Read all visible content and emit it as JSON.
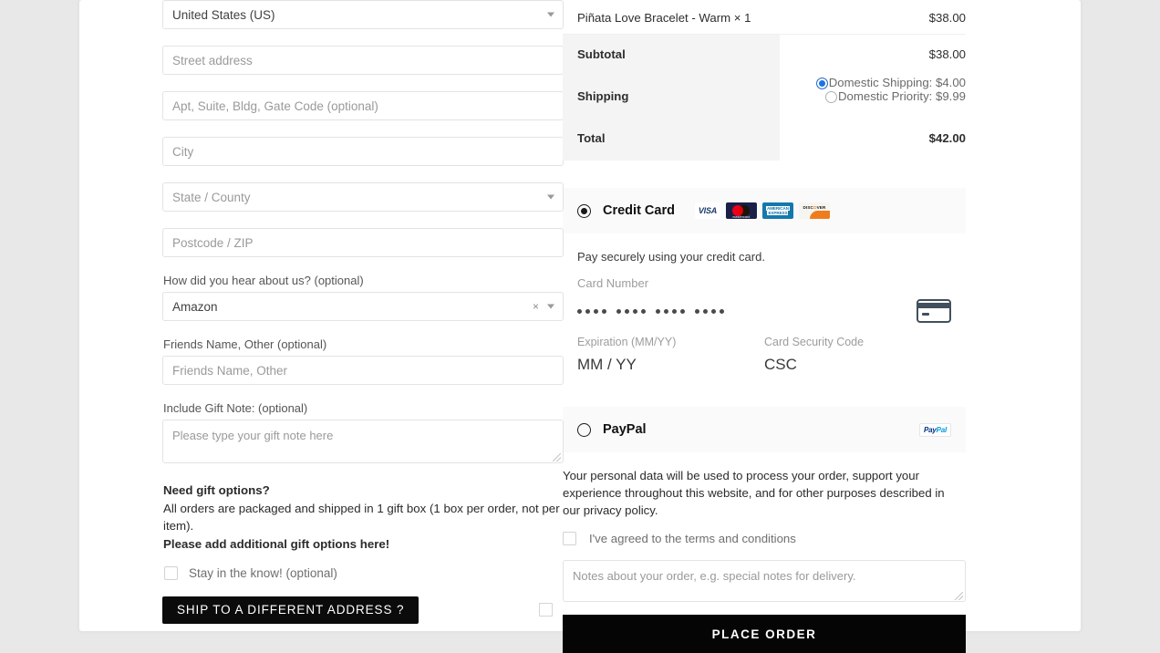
{
  "billing": {
    "country": {
      "value": "United States (US)",
      "icon": "chevron-down-icon"
    },
    "street": {
      "placeholder": "Street address"
    },
    "apt": {
      "placeholder": "Apt, Suite, Bldg, Gate Code (optional)"
    },
    "city": {
      "placeholder": "City"
    },
    "state": {
      "placeholder": "State / County"
    },
    "postcode": {
      "placeholder": "Postcode / ZIP"
    },
    "hear_about": {
      "label": "How did you hear about us? (optional)",
      "value": "Amazon",
      "clear_icon": "×"
    },
    "friends_name": {
      "label": "Friends Name, Other (optional)",
      "placeholder": "Friends Name, Other"
    },
    "gift_note": {
      "label": "Include Gift Note: (optional)",
      "placeholder": "Please type your gift note here"
    },
    "gift_options": {
      "heading": "Need gift options?",
      "line2": "All orders are packaged and shipped in 1 gift box (1 box per order, not per item).",
      "line3": "Please add additional gift options here!"
    },
    "newsletter": {
      "label": "Stay in the know! (optional)",
      "checked": false
    },
    "ship_different": {
      "label": "SHIP TO A DIFFERENT ADDRESS ?",
      "checked": false
    }
  },
  "order": {
    "line_item": {
      "name": "Piñata Love Bracelet - Warm  × 1",
      "amount": "$38.00"
    },
    "subtotal": {
      "label": "Subtotal",
      "amount": "$38.00"
    },
    "shipping": {
      "label": "Shipping",
      "options": [
        {
          "label": "Domestic Shipping: $4.00",
          "selected": true
        },
        {
          "label": "Domestic Priority: $9.99",
          "selected": false
        }
      ]
    },
    "total": {
      "label": "Total",
      "amount": "$42.00"
    }
  },
  "payment": {
    "credit_card": {
      "label": "Credit Card",
      "selected": true,
      "accepted_cards": [
        "VISA",
        "mastercard",
        "AMERICAN EXPRESS",
        "DISCOVER"
      ],
      "description": "Pay securely using your credit card.",
      "card_number_label": "Card Number",
      "card_number_masked": "•••• •••• •••• ••••",
      "card_icon": "credit-card-icon",
      "expiration_label": "Expiration (MM/YY)",
      "expiration_placeholder": "MM / YY",
      "csc_label": "Card Security Code",
      "csc_placeholder": "CSC"
    },
    "paypal": {
      "label": "PayPal",
      "selected": false,
      "logo_text_a": "Pay",
      "logo_text_b": "Pal"
    }
  },
  "footer": {
    "privacy_text": "Your personal data will be used to process your order, support your experience throughout this website, and for other purposes described in our privacy policy.",
    "terms": {
      "label": "I've agreed to the terms and conditions",
      "checked": false
    },
    "notes_placeholder": "Notes about your order, e.g. special notes for delivery.",
    "place_order": "PLACE ORDER"
  },
  "colors": {
    "accent_dark": "#050505",
    "radio_blue": "#1a73e8",
    "panel_gray": "#f4f4f4",
    "page_bg": "#e8e8e8"
  }
}
